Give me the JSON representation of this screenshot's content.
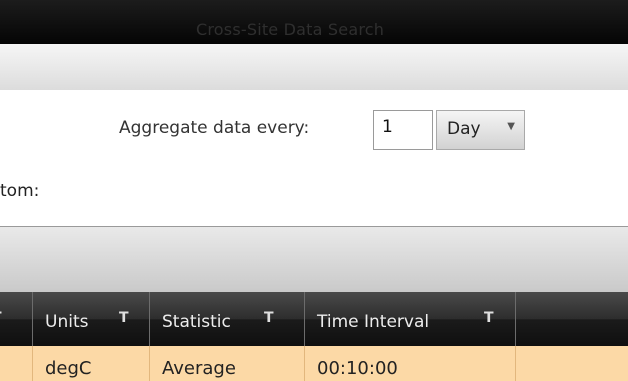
{
  "window": {
    "title": "Cross-Site Data Search"
  },
  "aggregate": {
    "label": "Aggregate data every:",
    "value": "1",
    "unit": "Day"
  },
  "fragment_label": "tom:",
  "grid": {
    "columns": [
      {
        "label": "",
        "filter_icon": "filter-icon"
      },
      {
        "label": "Units",
        "filter_icon": "filter-icon"
      },
      {
        "label": "Statistic",
        "filter_icon": "filter-icon"
      },
      {
        "label": "Time Interval",
        "filter_icon": "filter-icon"
      },
      {
        "label": ""
      }
    ],
    "rows": [
      {
        "cells": [
          "",
          "degC",
          "Average",
          "00:10:00",
          ""
        ]
      }
    ]
  },
  "colors": {
    "header_bg": "#1a1a1a",
    "row_highlight": "#fcd9a6",
    "band_gray": "#d4d4d4"
  }
}
